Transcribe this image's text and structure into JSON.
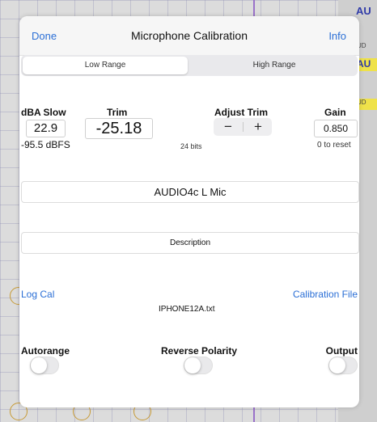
{
  "background": {
    "top_label": "AU",
    "chips": [
      "UD",
      "AU",
      "UD"
    ]
  },
  "dialog": {
    "title": "Microphone Calibration",
    "done_label": "Done",
    "info_label": "Info",
    "segments": {
      "low": "Low Range",
      "high": "High Range",
      "selected": "Low Range"
    },
    "dba": {
      "label": "dBA Slow",
      "value": "22.9",
      "dbfs": "-95.5 dBFS"
    },
    "trim": {
      "label": "Trim",
      "value": "-25.18"
    },
    "adjust_trim": {
      "label": "Adjust Trim",
      "minus": "−",
      "plus": "+"
    },
    "bits": "24 bits",
    "gain": {
      "label": "Gain",
      "value": "0.850",
      "hint": "0 to reset"
    },
    "mic_name": "AUDIO4c L Mic",
    "description": "Description",
    "log_cal": "Log Cal",
    "calibration_file_label": "Calibration File",
    "calibration_file_name": "IPHONE12A.txt",
    "toggles": {
      "autorange": {
        "label": "Autorange",
        "on": false
      },
      "reverse_polarity": {
        "label": "Reverse Polarity",
        "on": false
      },
      "output": {
        "label": "Output",
        "on": false
      }
    }
  },
  "colors": {
    "accent": "#2b6fd6",
    "toggle_off": "#e9e9eb"
  }
}
